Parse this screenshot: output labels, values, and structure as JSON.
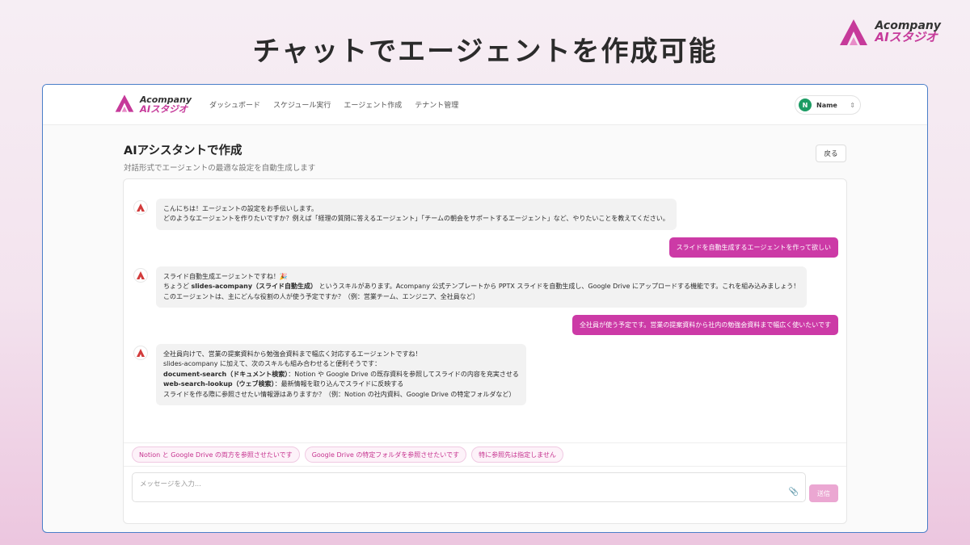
{
  "slide_title": "チャットでエージェントを作成可能",
  "brand": {
    "line1": "Acompany",
    "line2": "AIスタジオ",
    "accent": "#c63a9a"
  },
  "nav": {
    "items": [
      "ダッシュボード",
      "スケジュール実行",
      "エージェント作成",
      "テナント管理"
    ],
    "user": {
      "initial": "N",
      "name": "Name"
    }
  },
  "page": {
    "title": "AIアシスタントで作成",
    "subtitle": "対話形式でエージェントの最適な設定を自動生成します",
    "back_label": "戻る"
  },
  "chat": {
    "m1": {
      "l1": "こんにちは！エージェントの設定をお手伝いします。",
      "l2": "どのようなエージェントを作りたいですか？例えば「経理の質問に答えるエージェント」「チームの朝会をサポートするエージェント」など、やりたいことを教えてください。"
    },
    "u1": "スライドを自動生成するエージェントを作って欲しい",
    "m2": {
      "l1": "スライド自動生成エージェントですね！🎉",
      "l2_pre": "ちょうど ",
      "l2_bold": "slides-acompany（スライド自動生成）",
      "l2_post": " というスキルがあります。Acompany 公式テンプレートから PPTX スライドを自動生成し、Google Drive にアップロードする機能です。これを組み込みましょう！",
      "l3": "このエージェントは、主にどんな役割の人が使う予定ですか？（例：営業チーム、エンジニア、全社員など）"
    },
    "u2": "全社員が使う予定です。営業の提案資料から社内の勉強会資料まで幅広く使いたいです",
    "m3": {
      "l1": "全社員向けで、営業の提案資料から勉強会資料まで幅広く対応するエージェントですね！",
      "l2": "slides-acompany に加えて、次のスキルも組み合わせると便利そうです：",
      "l3_bold": "document-search（ドキュメント検索）",
      "l3_rest": "：Notion や Google Drive の既存資料を参照してスライドの内容を充実させる",
      "l4_bold": "web-search-lookup（ウェブ検索）",
      "l4_rest": "：最新情報を取り込んでスライドに反映する",
      "l5": "スライドを作る際に参照させたい情報源はありますか？（例：Notion の社内資料、Google Drive の特定フォルダなど）"
    }
  },
  "suggestions": [
    "Notion と Google Drive の両方を参照させたいです",
    "Google Drive の特定フォルダを参照させたいです",
    "特に参照先は指定しません"
  ],
  "input": {
    "placeholder": "メッセージを入力...",
    "send_label": "送信"
  }
}
